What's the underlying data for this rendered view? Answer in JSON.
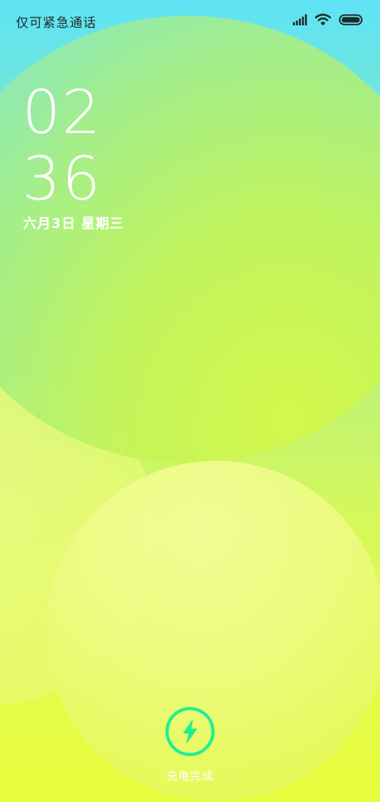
{
  "status_bar": {
    "carrier": "仅可紧急通话",
    "icons": [
      "signal-icon",
      "wifi-icon",
      "battery-icon"
    ]
  },
  "clock": {
    "hour": "02",
    "minute": "36",
    "date": "六月3日 星期三"
  },
  "charging": {
    "icon": "lightning-icon",
    "status": "充电完成",
    "accent_color": "#21ee94"
  }
}
